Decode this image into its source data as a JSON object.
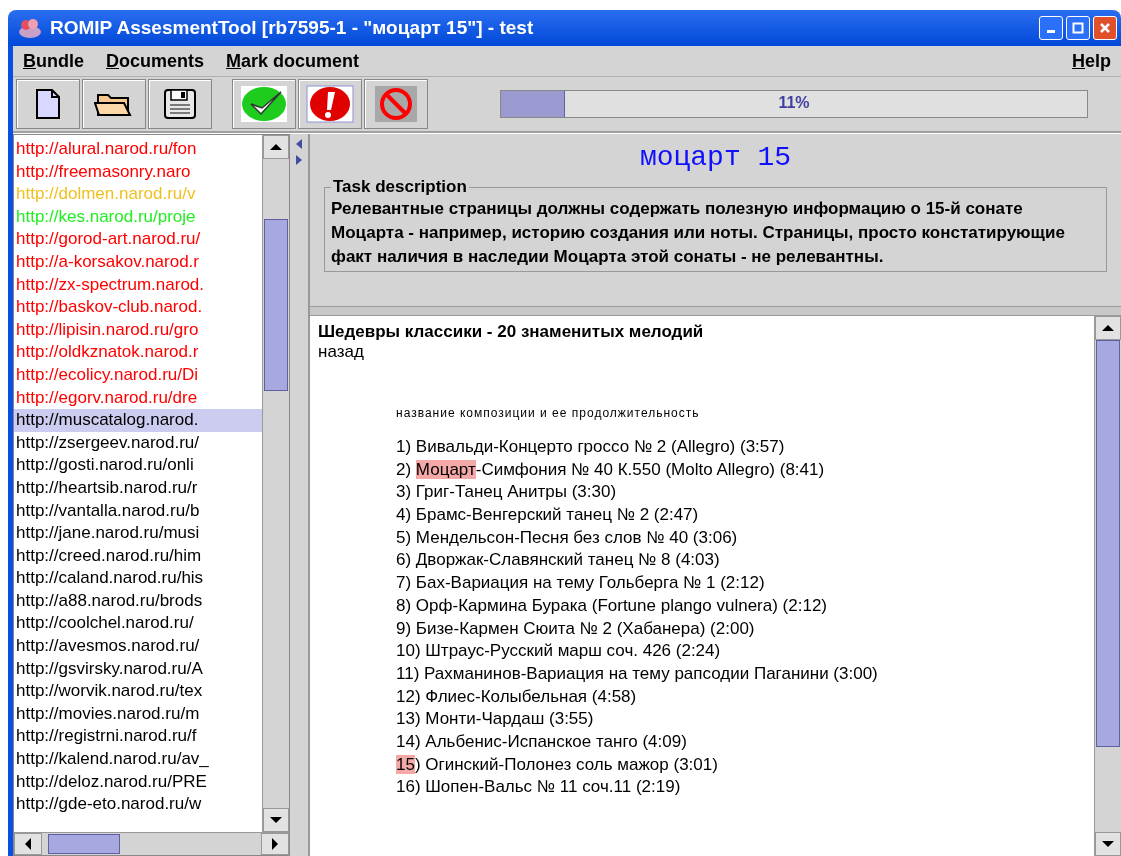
{
  "window": {
    "title": "ROMIP AssesmentTool [rb7595-1 - \"моцарт 15\"] - test"
  },
  "menu": [
    {
      "label": "Bundle"
    },
    {
      "label": "Documents"
    },
    {
      "label": "Mark document"
    }
  ],
  "help_menu": {
    "label": "Help"
  },
  "progress": {
    "level": 0.11,
    "text": "11%"
  },
  "documents": [
    {
      "url": "http://alural.narod.ru/fon",
      "color": "#ff0000",
      "selected": false
    },
    {
      "url": "http://freemasonry.naro",
      "color": "#ff0000",
      "selected": false
    },
    {
      "url": "http://dolmen.narod.ru/v",
      "color": "#f0c020",
      "selected": false
    },
    {
      "url": "http://kes.narod.ru/proje",
      "color": "#22ee22",
      "selected": false
    },
    {
      "url": "http://gorod-art.narod.ru/",
      "color": "#ff0000",
      "selected": false
    },
    {
      "url": "http://a-korsakov.narod.r",
      "color": "#ff0000",
      "selected": false
    },
    {
      "url": "http://zx-spectrum.narod.",
      "color": "#ff0000",
      "selected": false
    },
    {
      "url": "http://baskov-club.narod.",
      "color": "#ff0000",
      "selected": false
    },
    {
      "url": "http://lipisin.narod.ru/gro",
      "color": "#ff0000",
      "selected": false
    },
    {
      "url": "http://oldkznatok.narod.r",
      "color": "#ff0000",
      "selected": false
    },
    {
      "url": "http://ecolicy.narod.ru/Di",
      "color": "#ff0000",
      "selected": false
    },
    {
      "url": "http://egorv.narod.ru/dre",
      "color": "#ff0000",
      "selected": false
    },
    {
      "url": "http://muscatalog.narod.",
      "color": "#000000",
      "selected": true
    },
    {
      "url": "http://zsergeev.narod.ru/",
      "color": "#000000",
      "selected": false
    },
    {
      "url": "http://gosti.narod.ru/onli",
      "color": "#000000",
      "selected": false
    },
    {
      "url": "http://heartsib.narod.ru/r",
      "color": "#000000",
      "selected": false
    },
    {
      "url": "http://vantalla.narod.ru/b",
      "color": "#000000",
      "selected": false
    },
    {
      "url": "http://jane.narod.ru/musi",
      "color": "#000000",
      "selected": false
    },
    {
      "url": "http://creed.narod.ru/him",
      "color": "#000000",
      "selected": false
    },
    {
      "url": "http://caland.narod.ru/his",
      "color": "#000000",
      "selected": false
    },
    {
      "url": "http://a88.narod.ru/brods",
      "color": "#000000",
      "selected": false
    },
    {
      "url": "http://coolchel.narod.ru/",
      "color": "#000000",
      "selected": false
    },
    {
      "url": "http://avesmos.narod.ru/",
      "color": "#000000",
      "selected": false
    },
    {
      "url": "http://gsvirsky.narod.ru/A",
      "color": "#000000",
      "selected": false
    },
    {
      "url": "http://worvik.narod.ru/tex",
      "color": "#000000",
      "selected": false
    },
    {
      "url": "http://movies.narod.ru/m",
      "color": "#000000",
      "selected": false
    },
    {
      "url": "http://registrni.narod.ru/f",
      "color": "#000000",
      "selected": false
    },
    {
      "url": "http://kalend.narod.ru/av_",
      "color": "#000000",
      "selected": false
    },
    {
      "url": "http://deloz.narod.ru/PRE",
      "color": "#000000",
      "selected": false
    },
    {
      "url": "http://gde-eto.narod.ru/w",
      "color": "#000000",
      "selected": false
    }
  ],
  "query": {
    "title": "моцарт 15",
    "task_label": "Task description",
    "task_text": "Релевантные страницы должны содержать полезную информацию о 15-й сонате Моцарта - например, историю создания или ноты. Страницы, просто констатирующие факт наличия в наследии Моцарта этой сонаты - не релевантны."
  },
  "page": {
    "heading": "Шедевры классики - 20 знаменитых мелодий",
    "back_link": "назад",
    "caption": "название композиции и ее продолжительность",
    "lines": [
      [
        {
          "text": "1) Вивальди-Концерто гроссо № 2 (Allegro) (3:57)",
          "highlight": false
        }
      ],
      [
        {
          "text": "2) ",
          "highlight": false
        },
        {
          "text": "Моцарт",
          "highlight": true
        },
        {
          "text": "-Симфония № 40 К.550 (Molto Allegro) (8:41)",
          "highlight": false
        }
      ],
      [
        {
          "text": "3) Григ-Танец Анитры (3:30)",
          "highlight": false
        }
      ],
      [
        {
          "text": "4) Брамс-Венгерский танец № 2 (2:47)",
          "highlight": false
        }
      ],
      [
        {
          "text": "5) Мендельсон-Песня без слов № 40 (3:06)",
          "highlight": false
        }
      ],
      [
        {
          "text": "6) Дворжак-Славянский танец № 8 (4:03)",
          "highlight": false
        }
      ],
      [
        {
          "text": "7) Бах-Вариация на тему Гольберга № 1 (2:12)",
          "highlight": false
        }
      ],
      [
        {
          "text": "8) Орф-Кармина Бурака (Fortune plango vulnera) (2:12)",
          "highlight": false
        }
      ],
      [
        {
          "text": "9) Бизе-Кармен Сюита № 2 (Хабанера) (2:00)",
          "highlight": false
        }
      ],
      [
        {
          "text": "10) Штраус-Русский марш соч. 426 (2:24)",
          "highlight": false
        }
      ],
      [
        {
          "text": "11) Рахманинов-Вариация на тему рапсодии Паганини (3:00)",
          "highlight": false
        }
      ],
      [
        {
          "text": "12) Флиес-Колыбельная (4:58)",
          "highlight": false
        }
      ],
      [
        {
          "text": "13) Монти-Чардаш (3:55)",
          "highlight": false
        }
      ],
      [
        {
          "text": "14) Альбенис-Испанское танго (4:09)",
          "highlight": false
        }
      ],
      [
        {
          "text": "15",
          "highlight": true
        },
        {
          "text": ") Огинский-Полонез соль мажор (3:01)",
          "highlight": false
        }
      ],
      [
        {
          "text": "16) Шопен-Вальс № 11 соч.11 (2:19)",
          "highlight": false
        }
      ]
    ]
  }
}
